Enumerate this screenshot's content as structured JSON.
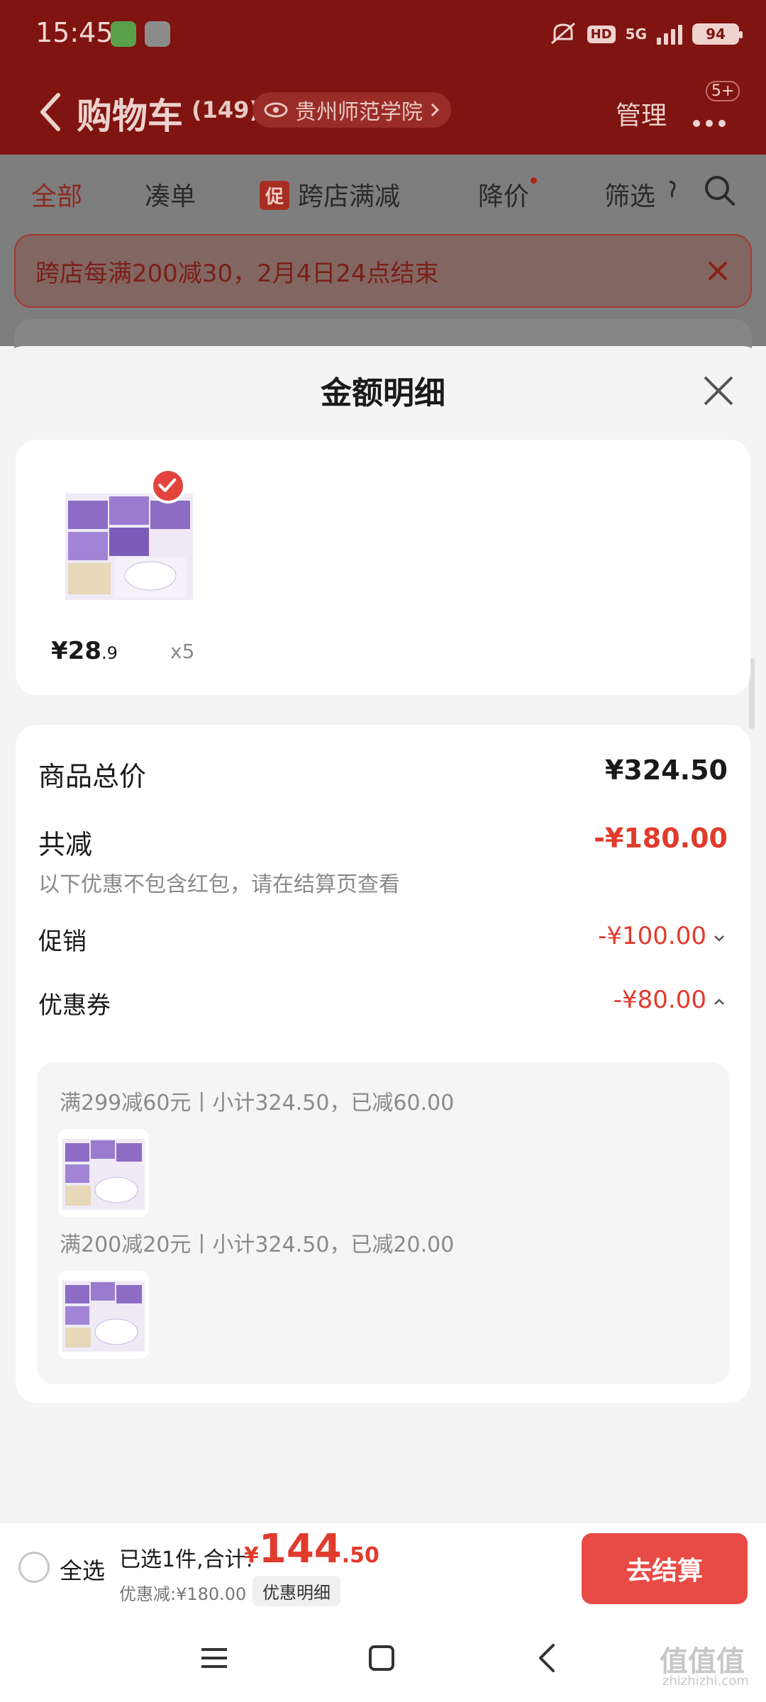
{
  "status_bar": {
    "time": "15:45",
    "hd": "HD",
    "network": "5G",
    "battery": "94"
  },
  "nav": {
    "title": "购物车",
    "count": "(149)",
    "location": "贵州师范学院",
    "manage": "管理",
    "badge": "5+"
  },
  "tabs": {
    "all": "全部",
    "combine": "凑单",
    "promo_chip": "促",
    "cross_store": "跨店满减",
    "price_drop": "降价",
    "filter": "筛选"
  },
  "banner": {
    "text": "跨店每满200减30，2月4日24点结束"
  },
  "sheet": {
    "title": "金额明细",
    "product": {
      "price_int": "¥28",
      "price_dec": ".9",
      "qty": "x5"
    },
    "summary": {
      "goods_total_label": "商品总价",
      "goods_total_value": "¥324.50",
      "total_reduce_label": "共减",
      "total_reduce_value": "-¥180.00",
      "note": "以下优惠不包含红包，请在结算页查看",
      "promo_label": "促销",
      "promo_value": "-¥100.00",
      "coupon_label": "优惠券",
      "coupon_value": "-¥80.00"
    },
    "coupons": [
      {
        "text": "满299减60元丨小计324.50，已减60.00"
      },
      {
        "text": "满200减20元丨小计324.50，已减20.00"
      }
    ]
  },
  "bottom_bar": {
    "select_all": "全选",
    "selected": "已选1件,合计:",
    "currency": "¥",
    "total_int": "144",
    "total_dec": ".50",
    "discount": "优惠减:¥180.00",
    "detail": "优惠明细",
    "checkout": "去结算"
  },
  "watermark": {
    "main": "值值值",
    "url": "zhizhizhi.com"
  },
  "colors": {
    "header": "#7f1410",
    "accent_red": "#e03b2c",
    "checkout": "#e84a45"
  }
}
